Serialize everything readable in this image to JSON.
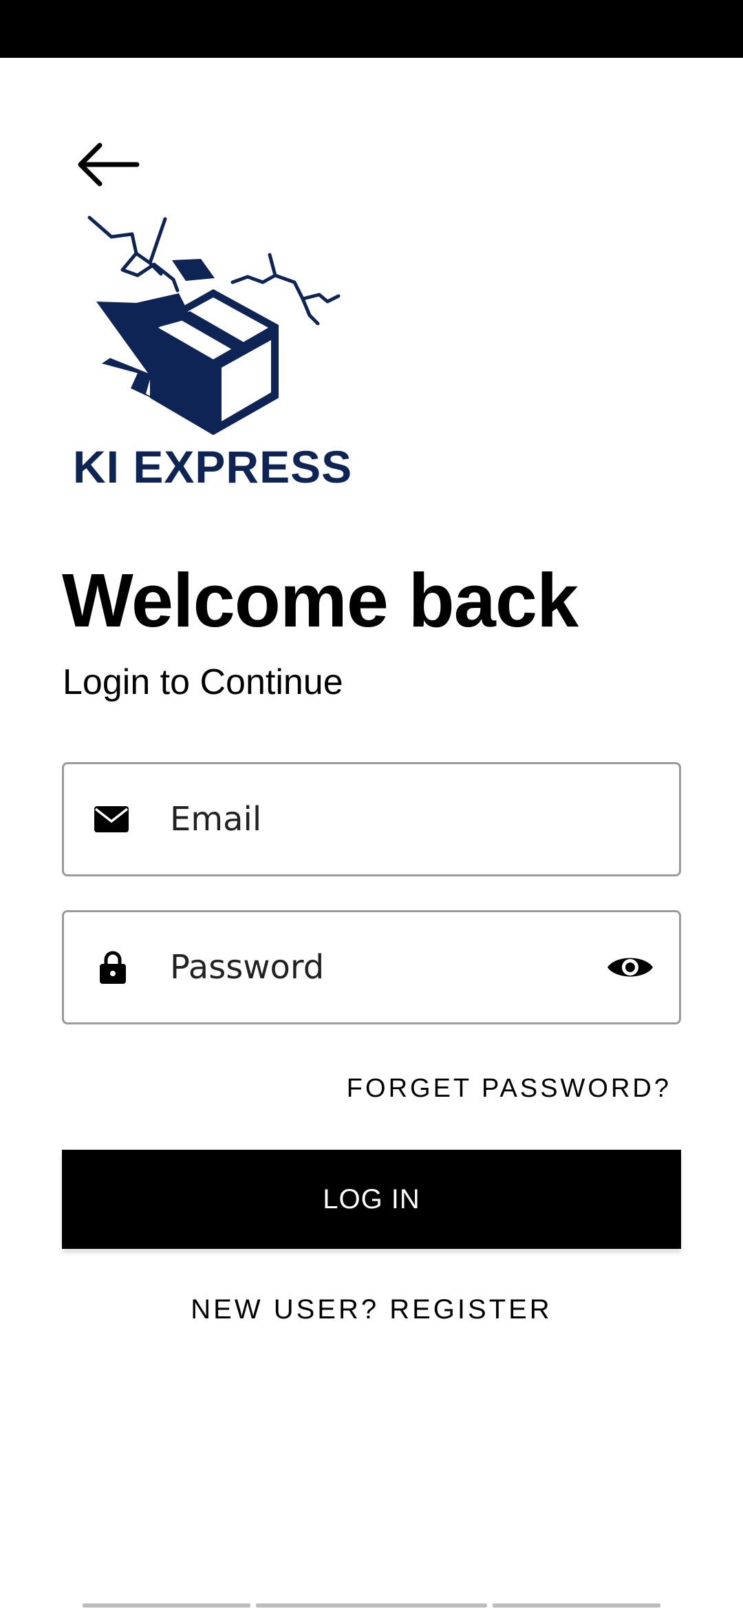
{
  "header": {
    "back_icon": "arrow-left-icon"
  },
  "brand": {
    "name": "KI EXPRESS",
    "color": "#0d2454",
    "logo_icon": "broken-box-logo"
  },
  "heading": {
    "title": "Welcome back",
    "subtitle": "Login to Continue"
  },
  "form": {
    "email": {
      "placeholder": "Email",
      "value": "",
      "icon": "envelope-icon"
    },
    "password": {
      "placeholder": "Password",
      "value": "",
      "icon": "lock-icon",
      "toggle_icon": "eye-icon"
    },
    "forgot_label": "FORGET PASSWORD?",
    "login_label": "LOG IN",
    "register_label": "NEW USER? REGISTER"
  }
}
